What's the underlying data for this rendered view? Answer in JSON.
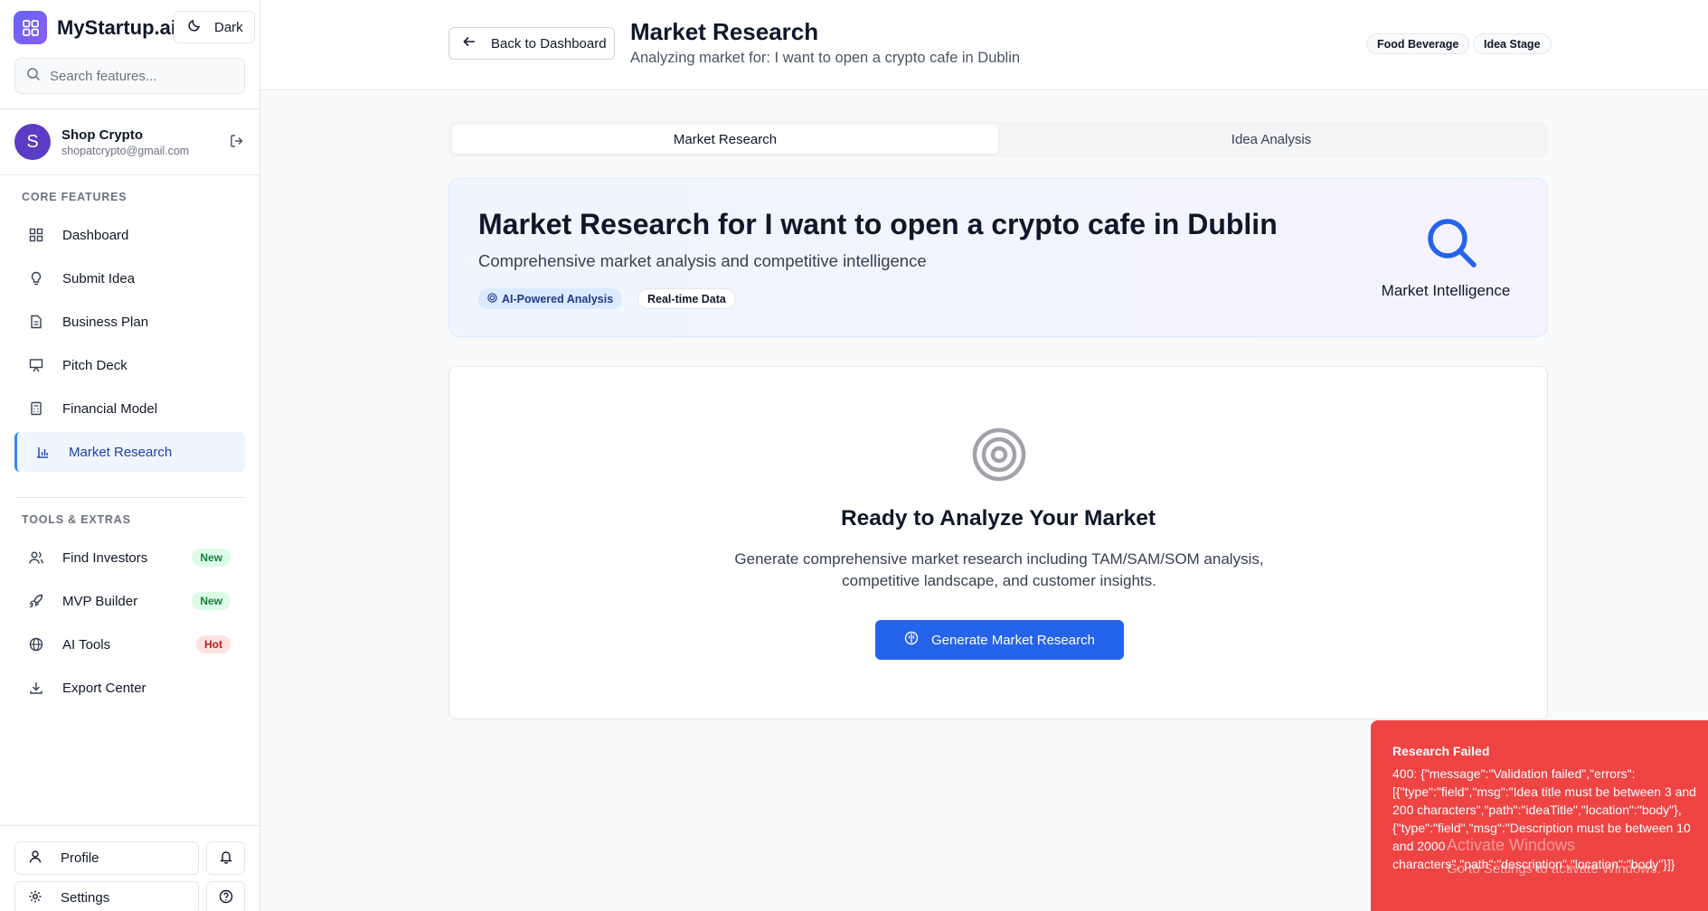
{
  "sidebar": {
    "brand": "MyStartup.ai",
    "theme_toggle": "Dark",
    "search_placeholder": "Search features...",
    "user": {
      "initial": "S",
      "name": "Shop Crypto",
      "email": "shopatcrypto@gmail.com"
    },
    "core_label": "CORE FEATURES",
    "core_items": [
      {
        "label": "Dashboard",
        "icon": "grid-icon"
      },
      {
        "label": "Submit Idea",
        "icon": "lightbulb-icon"
      },
      {
        "label": "Business Plan",
        "icon": "document-icon"
      },
      {
        "label": "Pitch Deck",
        "icon": "presentation-icon"
      },
      {
        "label": "Financial Model",
        "icon": "calculator-icon"
      },
      {
        "label": "Market Research",
        "icon": "bar-chart-icon",
        "active": true
      }
    ],
    "tools_label": "TOOLS & EXTRAS",
    "tools_items": [
      {
        "label": "Find Investors",
        "badge": "New",
        "icon": "users-icon"
      },
      {
        "label": "MVP Builder",
        "badge": "New",
        "icon": "rocket-icon"
      },
      {
        "label": "AI Tools",
        "badge": "Hot",
        "icon": "globe-icon"
      },
      {
        "label": "Export Center",
        "icon": "download-icon"
      }
    ],
    "profile_label": "Profile",
    "settings_label": "Settings"
  },
  "header": {
    "back_label": "Back to Dashboard",
    "title": "Market Research",
    "subtitle": "Analyzing market for: I want to open a crypto cafe in Dublin",
    "tags": [
      "Food Beverage",
      "Idea Stage"
    ]
  },
  "tabs": [
    "Market Research",
    "Idea Analysis"
  ],
  "hero": {
    "title": "Market Research for I want to open a crypto cafe in Dublin",
    "subtitle": "Comprehensive market analysis and competitive intelligence",
    "tag_ai": "AI-Powered Analysis",
    "tag_rt": "Real-time Data",
    "icon_label": "Market Intelligence"
  },
  "empty": {
    "title": "Ready to Analyze Your Market",
    "description": "Generate comprehensive market research including TAM/SAM/SOM analysis, competitive landscape, and customer insights.",
    "button": "Generate Market Research"
  },
  "toast": {
    "title": "Research Failed",
    "message": "400: {\"message\":\"Validation failed\",\"errors\":[{\"type\":\"field\",\"msg\":\"Idea title must be between 3 and 200 characters\",\"path\":\"ideaTitle\",\"location\":\"body\"},{\"type\":\"field\",\"msg\":\"Description must be between 10 and 2000 characters\",\"path\":\"description\",\"location\":\"body\"}]}"
  },
  "os_watermark": {
    "title": "Activate Windows",
    "subtitle": "Go to Settings to activate Windows."
  },
  "colors": {
    "accent": "#2563eb",
    "brand_gradient_start": "#6366f1",
    "avatar": "#5b3cc4",
    "error": "#ef4444"
  }
}
